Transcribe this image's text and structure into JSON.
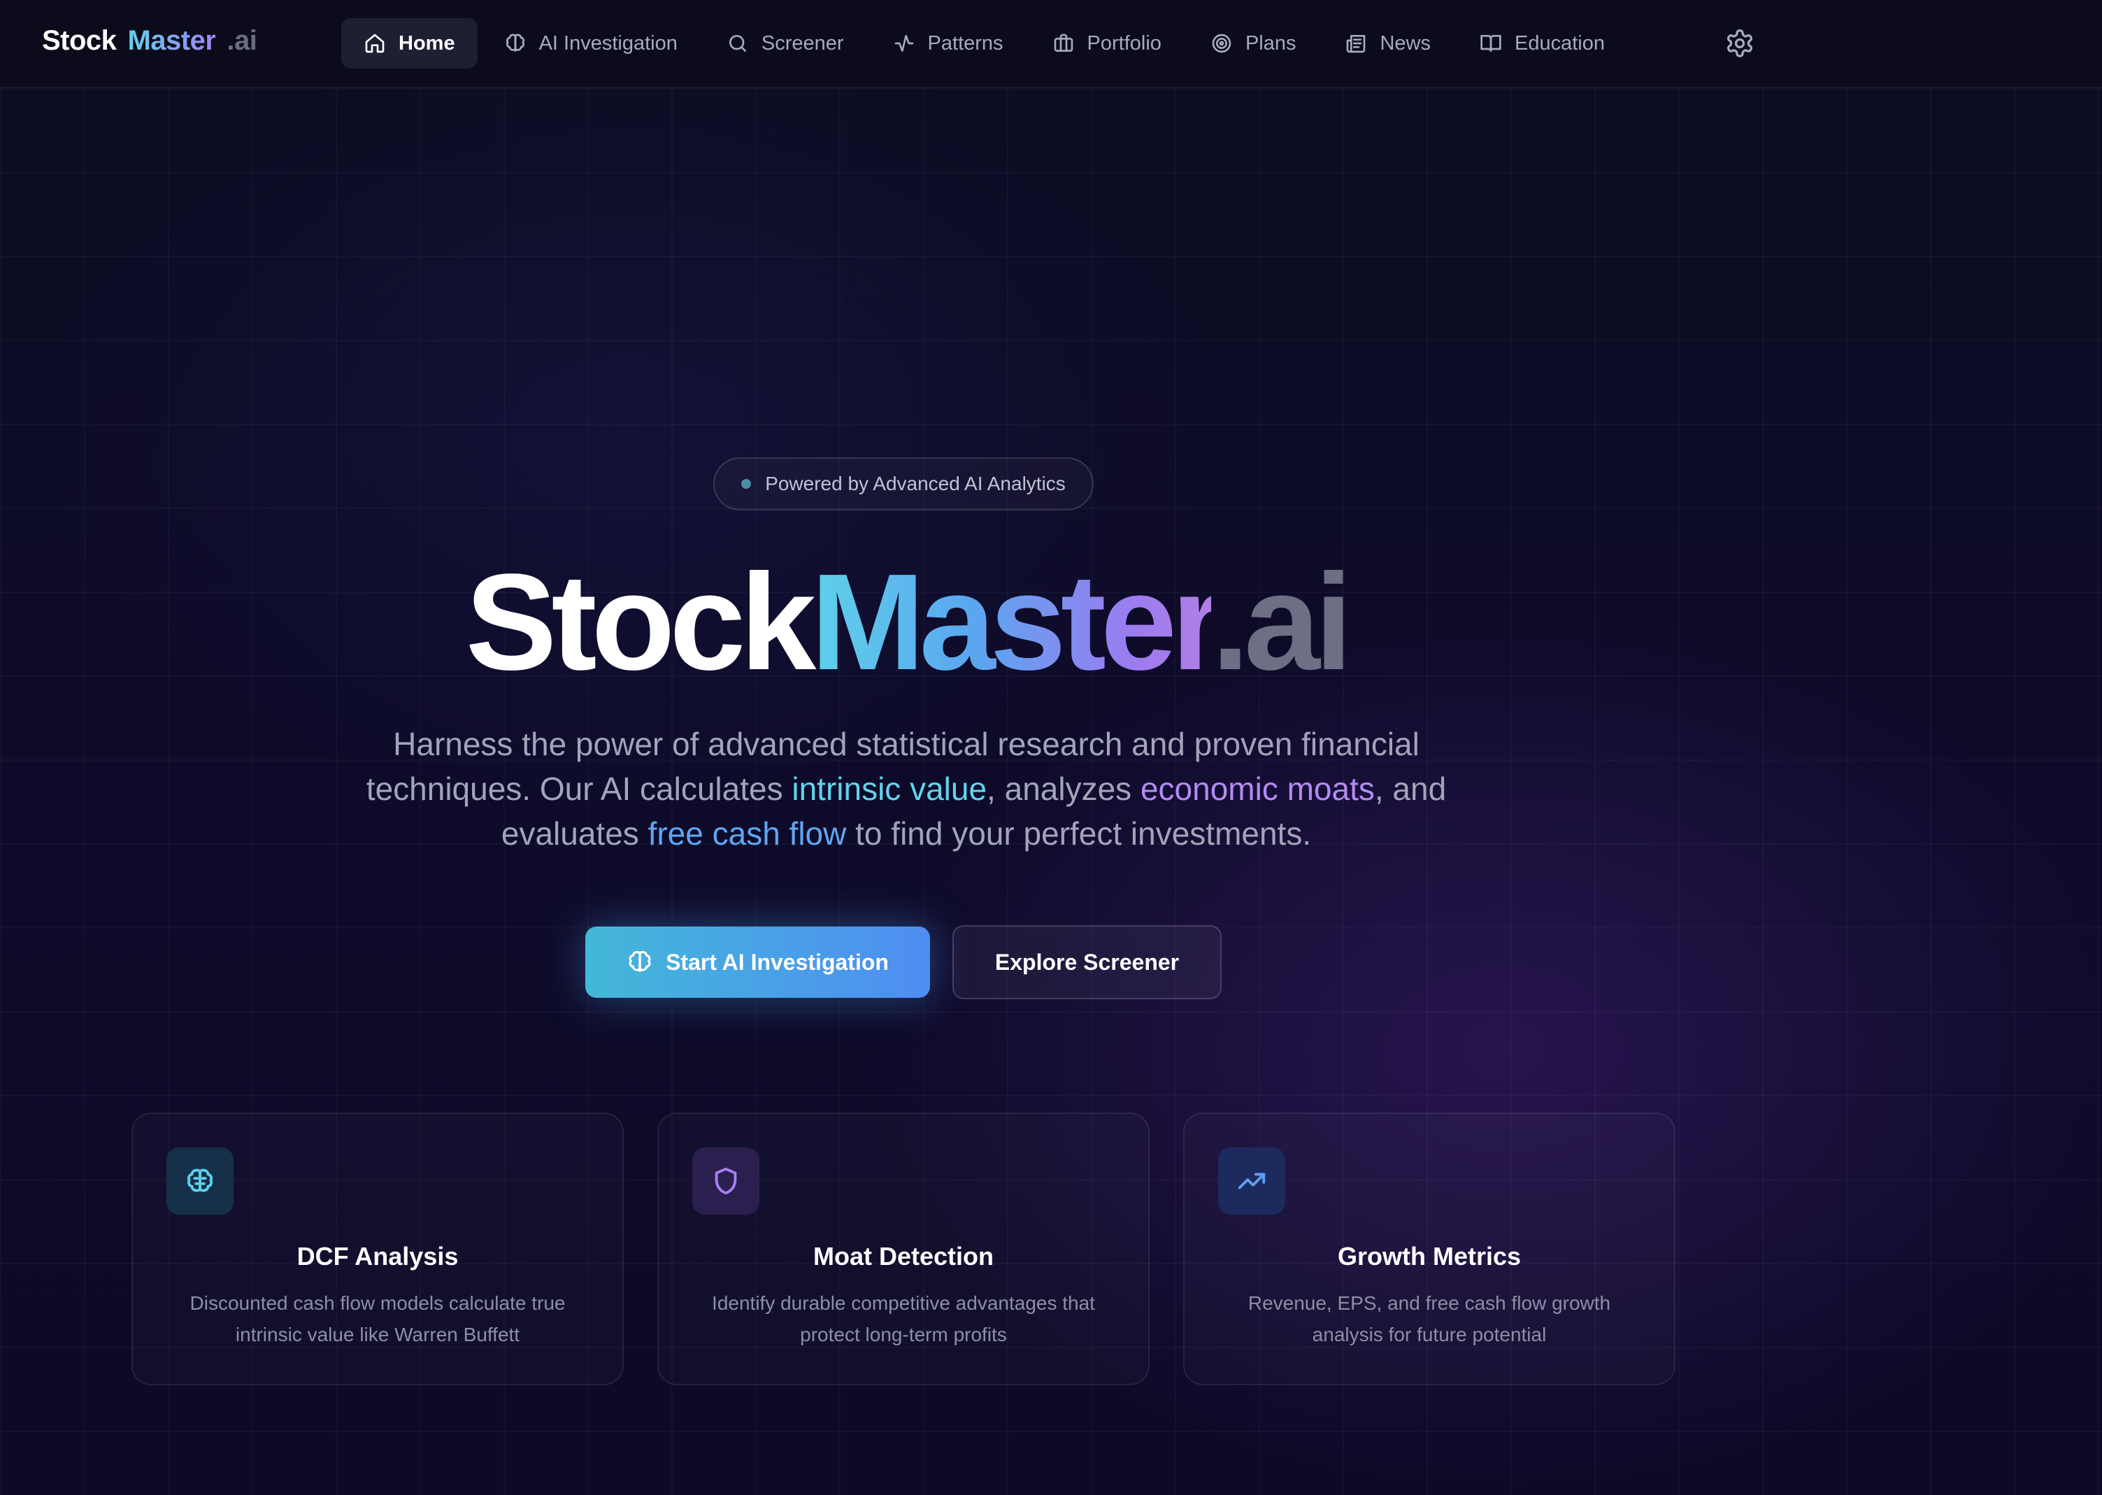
{
  "logo": {
    "part1": "Stock",
    "part2": "Master",
    "part3": ".ai"
  },
  "nav": {
    "items": [
      {
        "label": "Home",
        "icon": "home-icon",
        "active": true
      },
      {
        "label": "AI Investigation",
        "icon": "brain-icon",
        "active": false
      },
      {
        "label": "Screener",
        "icon": "search-icon",
        "active": false
      },
      {
        "label": "Patterns",
        "icon": "activity-icon",
        "active": false
      },
      {
        "label": "Portfolio",
        "icon": "briefcase-icon",
        "active": false
      },
      {
        "label": "Plans",
        "icon": "target-icon",
        "active": false
      },
      {
        "label": "News",
        "icon": "newspaper-icon",
        "active": false
      },
      {
        "label": "Education",
        "icon": "book-open-icon",
        "active": false
      }
    ],
    "settings_icon": "gear-icon"
  },
  "hero": {
    "badge": "Powered by Advanced AI Analytics",
    "title": {
      "part1": "Stock",
      "part2": "Master",
      "part3": ".ai"
    },
    "description": {
      "line1": "Harness the power of advanced statistical research and proven financial techniques. Our AI calculates ",
      "highlight1": "intrinsic value",
      "line2": ", analyzes ",
      "highlight2": "economic moats",
      "line3": ", and evaluates ",
      "highlight3": "free cash flow",
      "line4": " to find your perfect investments."
    },
    "primary_button": "Start AI Investigation",
    "secondary_button": "Explore Screener"
  },
  "features": [
    {
      "title": "DCF Analysis",
      "description": "Discounted cash flow models calculate true intrinsic value like Warren Buffett",
      "icon": "brain-icon"
    },
    {
      "title": "Moat Detection",
      "description": "Identify durable competitive advantages that protect long-term profits",
      "icon": "shield-icon"
    },
    {
      "title": "Growth Metrics",
      "description": "Revenue, EPS, and free cash flow growth analysis for future potential",
      "icon": "trending-up-icon"
    }
  ],
  "colors": {
    "background": "#0b0b1f",
    "accent_cyan": "#62d3ec",
    "accent_blue": "#4f8df2",
    "accent_purple": "#b48bf2"
  }
}
